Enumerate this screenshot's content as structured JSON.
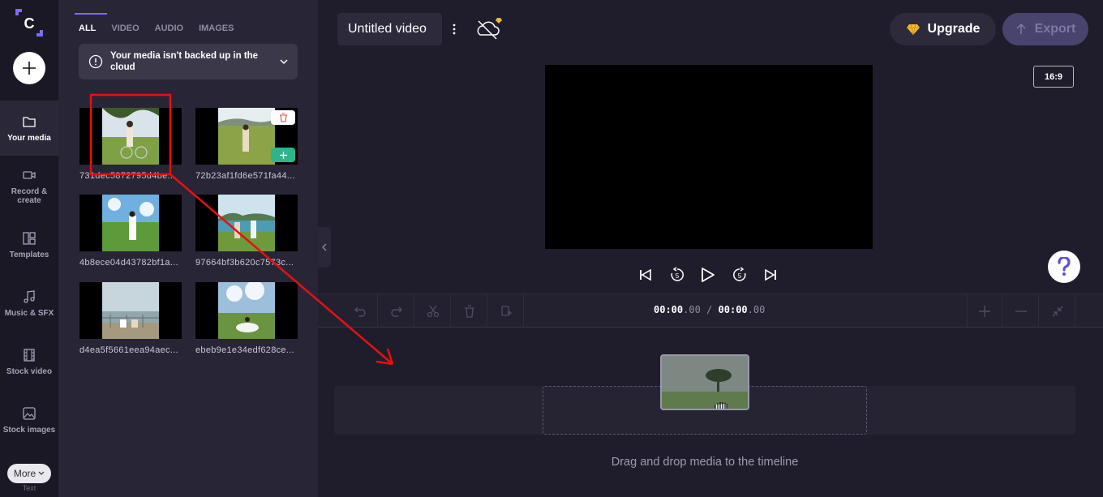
{
  "nav": {
    "items": [
      {
        "label": "Your media",
        "icon": "folder-icon"
      },
      {
        "label": "Record & create",
        "icon": "video-camera-icon"
      },
      {
        "label": "Templates",
        "icon": "templates-icon"
      },
      {
        "label": "Music & SFX",
        "icon": "music-note-icon"
      },
      {
        "label": "Stock video",
        "icon": "film-icon"
      },
      {
        "label": "Stock images",
        "icon": "image-icon"
      }
    ],
    "more_label": "More",
    "more_sub": "Text"
  },
  "media": {
    "tabs": [
      "ALL",
      "VIDEO",
      "AUDIO",
      "IMAGES"
    ],
    "active_tab": "ALL",
    "notice": "Your media isn't backed up in the cloud",
    "items": [
      {
        "name": "731dec5872795d4be..."
      },
      {
        "name": "72b23af1fd6e571fa44..."
      },
      {
        "name": "4b8ece04d43782bf1a..."
      },
      {
        "name": "97664bf3b620c7573c..."
      },
      {
        "name": "d4ea5f5661eea94aec..."
      },
      {
        "name": "ebeb9e1e34edf628ce..."
      }
    ]
  },
  "header": {
    "title": "Untitled video",
    "upgrade_label": "Upgrade",
    "export_label": "Export",
    "aspect_ratio": "16:9"
  },
  "timeline": {
    "current_main": "00:00",
    "current_frac": ".00",
    "separator": "/",
    "total_main": "00:00",
    "total_frac": ".00",
    "drop_hint": "Drag and drop media to the timeline"
  },
  "colors": {
    "accent": "#7b6cf6",
    "add_green": "#2bb58a",
    "annotation_red": "#e81010",
    "gem_gold": "#f5b82e"
  }
}
